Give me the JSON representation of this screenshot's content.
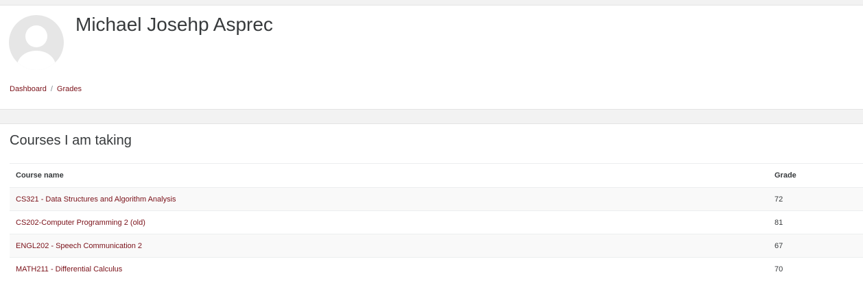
{
  "user": {
    "name": "Michael Josehp Asprec"
  },
  "breadcrumb": {
    "items": [
      "Dashboard",
      "Grades"
    ],
    "separator": "/"
  },
  "section": {
    "title": "Courses I am taking"
  },
  "table": {
    "headers": {
      "course": "Course name",
      "grade": "Grade"
    },
    "rows": [
      {
        "course": "CS321 - Data Structures and Algorithm Analysis",
        "grade": "72"
      },
      {
        "course": "CS202-Computer Programming 2 (old)",
        "grade": "81"
      },
      {
        "course": "ENGL202 - Speech Communication 2",
        "grade": "67"
      },
      {
        "course": "MATH211 - Differential Calculus",
        "grade": "70"
      }
    ]
  },
  "colors": {
    "link": "#7a1018",
    "text": "#373a3c",
    "page_bg": "#f2f2f2"
  }
}
